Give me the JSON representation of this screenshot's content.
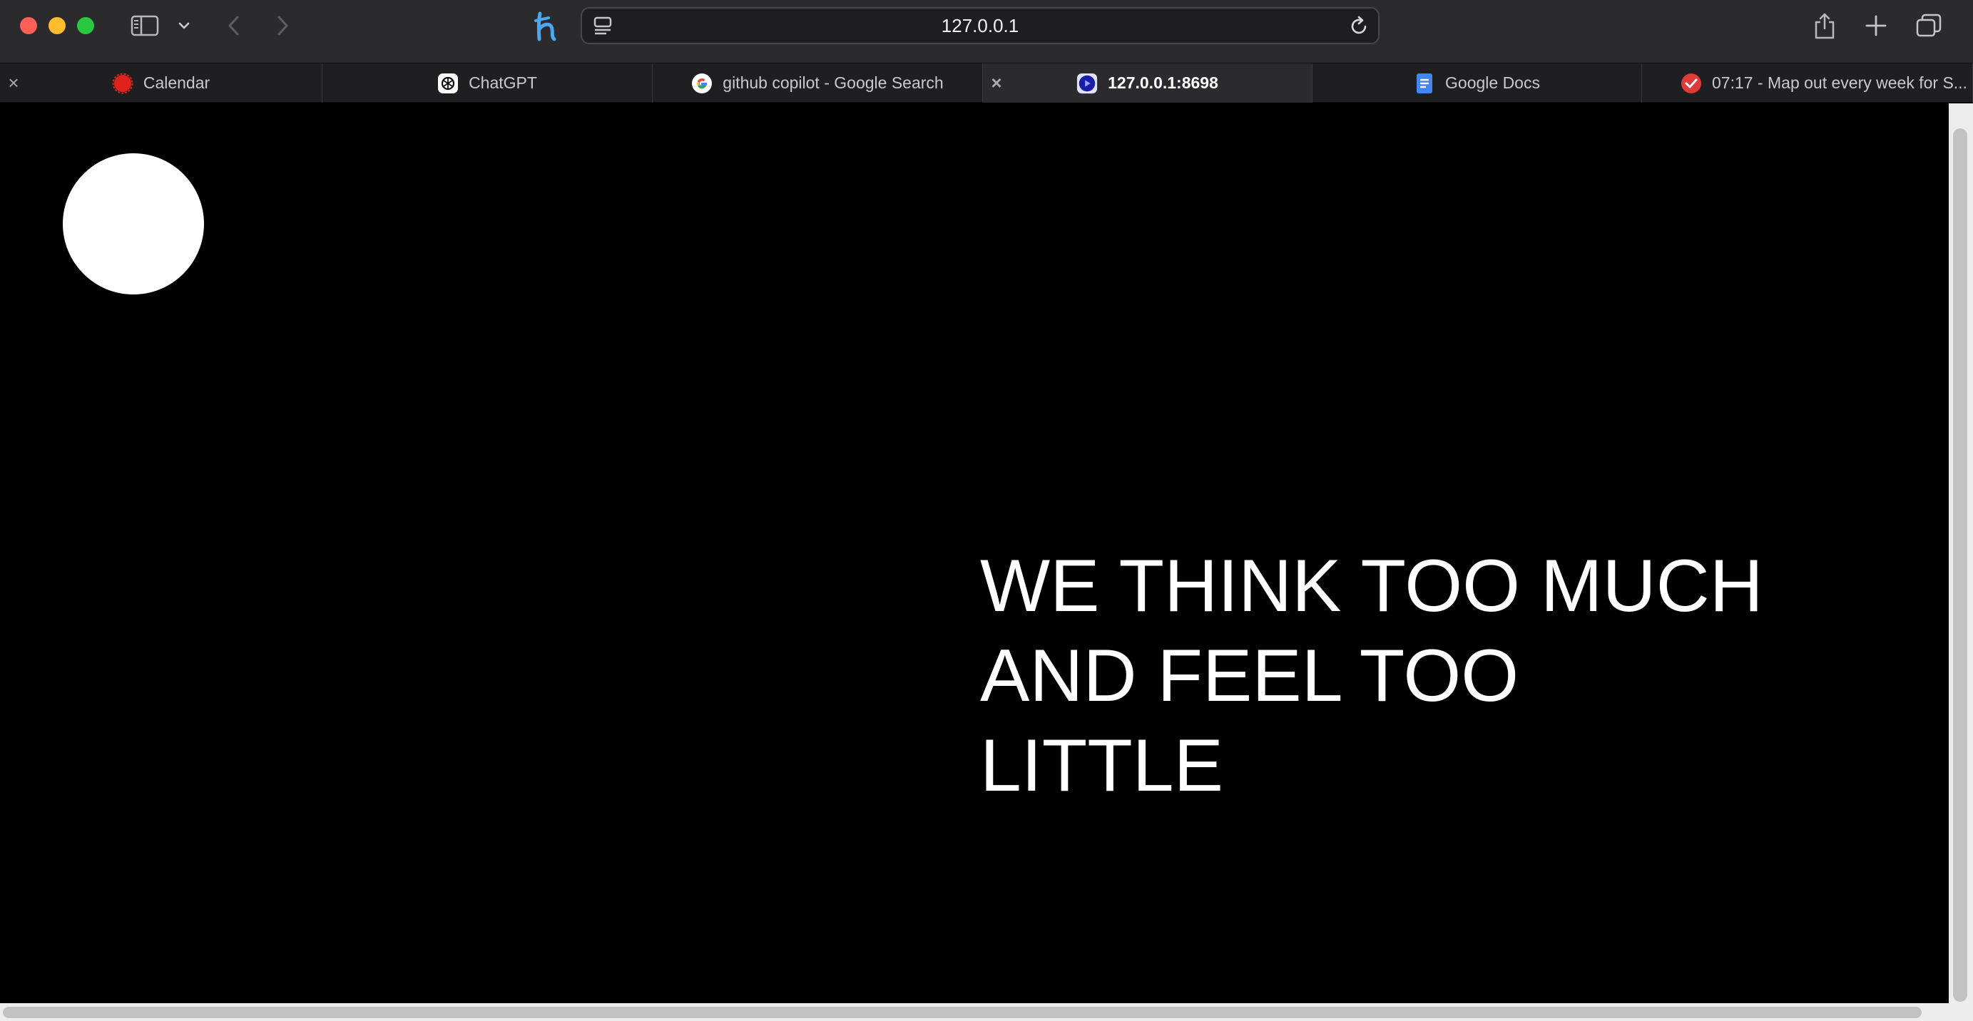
{
  "window": {
    "controls": [
      "close",
      "minimize",
      "zoom"
    ]
  },
  "toolbar": {
    "address": {
      "url": "127.0.0.1"
    },
    "icons": {
      "sidebar": "sidebar-icon",
      "sidebar_menu": "chevron-down-icon",
      "back": "chevron-left-icon",
      "forward": "chevron-right-icon",
      "extension": "honey-extension-icon",
      "page_menu": "page-menu-icon",
      "reload": "reload-icon",
      "share": "share-icon",
      "new_tab": "plus-icon",
      "tab_overview": "tab-overview-icon"
    }
  },
  "tabs": [
    {
      "label": "Calendar",
      "icon": "calendar-icon",
      "active": false
    },
    {
      "label": "ChatGPT",
      "icon": "chatgpt-icon",
      "active": false
    },
    {
      "label": "github copilot - Google Search",
      "icon": "google-icon",
      "active": false
    },
    {
      "label": "127.0.0.1:8698",
      "icon": "local-page-icon",
      "active": true
    },
    {
      "label": "Google Docs",
      "icon": "google-docs-icon",
      "active": false
    },
    {
      "label": "07:17 - Map out every week for S...",
      "icon": "task-check-icon",
      "active": false
    }
  ],
  "page": {
    "quote_lines": [
      "WE THINK TOO MUCH",
      "AND FEEL TOO",
      "LITTLE"
    ]
  },
  "colors": {
    "page_background": "#000000",
    "text": "#ffffff",
    "circle": "#ffffff",
    "toolbar": "#2b2a2d",
    "accent_link": "#4aa8f0"
  }
}
